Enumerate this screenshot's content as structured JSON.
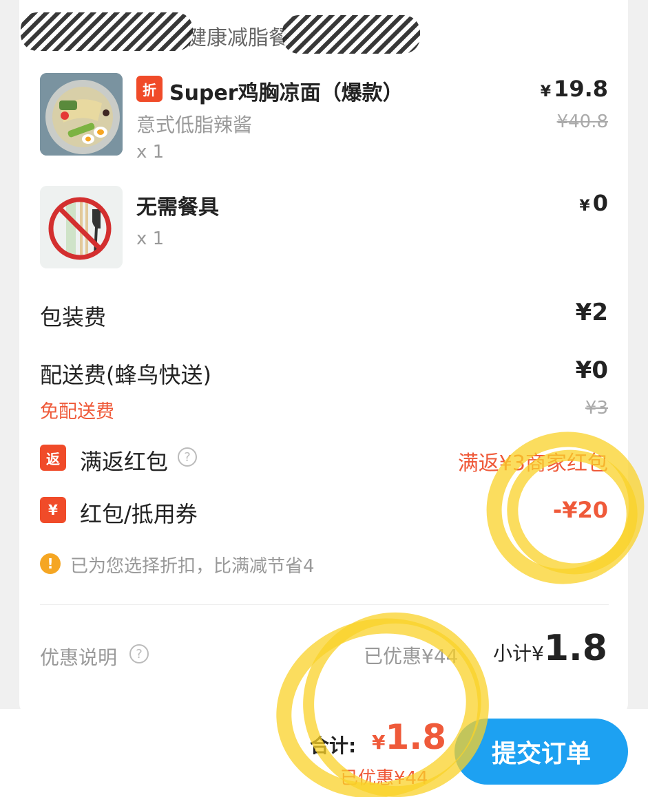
{
  "shop": {
    "name": "健康减脂餐"
  },
  "items": [
    {
      "tag": "折",
      "title": "Super鸡胸凉面（爆款）",
      "subtitle": "意式低脂辣酱",
      "qty": "x 1",
      "currency": "¥",
      "price": "19.8",
      "original_price": "¥40.8"
    },
    {
      "title": "无需餐具",
      "qty": "x 1",
      "currency": "¥",
      "price": "0"
    }
  ],
  "fees": {
    "packaging_label": "包装费",
    "packaging_value": "¥2",
    "delivery_label": "配送费(蜂鸟快送)",
    "delivery_value": "¥0",
    "free_delivery_label": "免配送费",
    "delivery_original": "¥3"
  },
  "promos": {
    "rebate_tag": "返",
    "rebate_label": "满返红包",
    "rebate_value": "满返¥3商家红包",
    "coupon_tag": "¥",
    "coupon_label": "红包/抵用券",
    "coupon_value": "-¥20",
    "notice_icon": "!",
    "notice_text": "已为您选择折扣，比满减节省4"
  },
  "summary": {
    "discount_info_label": "优惠说明",
    "saved_text": "已优惠¥44",
    "subtotal_label": "小计¥",
    "subtotal_value": "1.8"
  },
  "bottom_bar": {
    "total_label": "合计:",
    "currency": "¥",
    "total_value": "1.8",
    "saved_text": "已优惠¥44",
    "submit_label": "提交订单"
  },
  "colors": {
    "accent_red": "#ef5a3a",
    "tag_red": "#f04b29",
    "submit_blue": "#1da1f2",
    "warning_orange": "#f5a623",
    "highlight_yellow": "#fad228"
  },
  "icons": {
    "help": "question-circle-icon",
    "warning": "exclamation-circle-icon"
  }
}
